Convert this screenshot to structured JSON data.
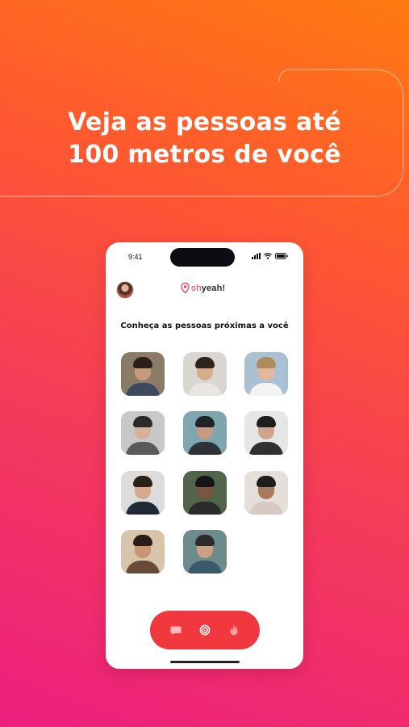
{
  "headline": {
    "line1": "Veja as pessoas até",
    "line2": "100 metros de você"
  },
  "status_bar": {
    "time": "9:41"
  },
  "app": {
    "logo": {
      "prefix": "oh",
      "suffix": "yeah",
      "punct": "!"
    },
    "section_title": "Conheça as pessoas próximas a você"
  },
  "people": [
    {
      "icon": "profile-photo-1",
      "bg": "#8a7a68",
      "hair": "#2a2018",
      "skin": "#c79a7a",
      "shirt": "#3b4a5c"
    },
    {
      "icon": "profile-photo-2",
      "bg": "#d9d6d2",
      "hair": "#2c231d",
      "skin": "#d8ad8d",
      "shirt": "#e9e6e1"
    },
    {
      "icon": "profile-photo-3",
      "bg": "#a9c1d3",
      "hair": "#b08a5c",
      "skin": "#e3b79b",
      "shirt": "#f4f4f4"
    },
    {
      "icon": "profile-photo-4",
      "bg": "#c8c8c8",
      "hair": "#2a2a2a",
      "skin": "#d7b099",
      "shirt": "#595959"
    },
    {
      "icon": "profile-photo-5",
      "bg": "#7fa6b0",
      "hair": "#1f2326",
      "skin": "#c49a80",
      "shirt": "#2e3338"
    },
    {
      "icon": "profile-photo-6",
      "bg": "#e6e6e6",
      "hair": "#1e1e1e",
      "skin": "#cfa48a",
      "shirt": "#303030"
    },
    {
      "icon": "profile-photo-7",
      "bg": "#dcdcdc",
      "hair": "#2b2119",
      "skin": "#d6a98b",
      "shirt": "#1f2a38"
    },
    {
      "icon": "profile-photo-8",
      "bg": "#51654a",
      "hair": "#151515",
      "skin": "#7b5540",
      "shirt": "#2b2b2b"
    },
    {
      "icon": "profile-photo-9",
      "bg": "#e4dfd8",
      "hair": "#1d1d1d",
      "skin": "#a87a5c",
      "shirt": "#d8c9c2"
    },
    {
      "icon": "profile-photo-10",
      "bg": "#d8c4a8",
      "hair": "#2a1d15",
      "skin": "#c89574",
      "shirt": "#6a4a3a"
    },
    {
      "icon": "profile-photo-11",
      "bg": "#6d8b8c",
      "hair": "#2a2a2a",
      "skin": "#c9a083",
      "shirt": "#3a5a6a"
    }
  ],
  "tabbar": {
    "icons": [
      "chat-icon",
      "nearby-radar-icon",
      "flame-icon"
    ],
    "active": "nearby-radar-icon"
  },
  "colors": {
    "accent": "#f2383f",
    "gradient_top": "#ff7a10",
    "gradient_bottom": "#ec1f7f"
  }
}
